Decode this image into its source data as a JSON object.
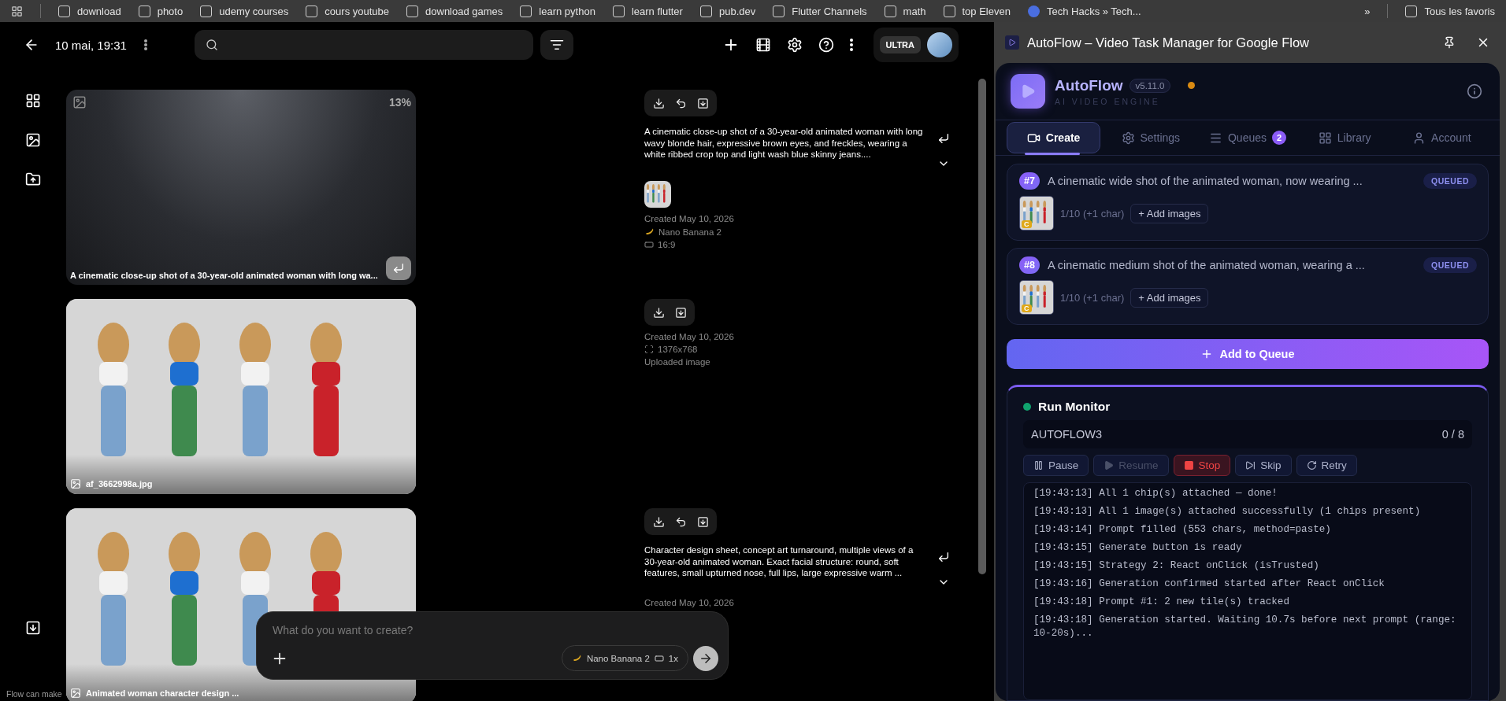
{
  "bookmarks": {
    "items": [
      {
        "label": "download",
        "kind": "folder"
      },
      {
        "label": "photo",
        "kind": "folder"
      },
      {
        "label": "udemy courses",
        "kind": "folder"
      },
      {
        "label": "cours youtube",
        "kind": "folder"
      },
      {
        "label": "download games",
        "kind": "folder"
      },
      {
        "label": "learn python",
        "kind": "folder"
      },
      {
        "label": "learn flutter",
        "kind": "folder"
      },
      {
        "label": "pub.dev",
        "kind": "folder"
      },
      {
        "label": "Flutter Channels",
        "kind": "folder"
      },
      {
        "label": "math",
        "kind": "folder"
      },
      {
        "label": "top Eleven",
        "kind": "folder"
      },
      {
        "label": "Tech Hacks » Tech...",
        "kind": "site"
      }
    ],
    "overflow": "»",
    "all": "Tous les favoris"
  },
  "header": {
    "title": "10 mai, 19:31",
    "plan": "ULTRA"
  },
  "cards": [
    {
      "kind": "progress",
      "progress": "13%",
      "caption": "A cinematic close-up shot of a 30-year-old animated woman with long wa..."
    },
    {
      "kind": "picture",
      "caption": "af_3662998a.jpg"
    },
    {
      "kind": "picture",
      "caption": "Animated woman character design ..."
    }
  ],
  "details": [
    {
      "actions": [
        {
          "kind": "download"
        },
        {
          "kind": "undo"
        },
        {
          "kind": "save"
        }
      ],
      "prompt": "A cinematic close-up shot of a 30-year-old animated woman with long wavy blonde hair, expressive brown eyes, and freckles, wearing a white ribbed crop top and light wash blue skinny jeans....",
      "thumbnail": true,
      "meta": [
        {
          "kind": "date",
          "text": "Created May 10, 2026"
        },
        {
          "kind": "model",
          "text": "Nano Banana 2"
        },
        {
          "kind": "ratio",
          "text": "16:9"
        }
      ]
    },
    {
      "actions": [
        {
          "kind": "download"
        },
        {
          "kind": "save"
        }
      ],
      "thumbnail": false,
      "meta": [
        {
          "kind": "date",
          "text": "Created May 10, 2026"
        },
        {
          "kind": "size",
          "text": "1376x768"
        },
        {
          "kind": "source",
          "text": "Uploaded image"
        }
      ]
    },
    {
      "actions": [
        {
          "kind": "download"
        },
        {
          "kind": "undo"
        },
        {
          "kind": "save"
        }
      ],
      "prompt": "Character design sheet, concept art turnaround, multiple views of a 30-year-old animated woman. Exact facial structure: round, soft features, small upturned nose, full lips, large expressive warm ...",
      "thumbnail": false,
      "meta": [
        {
          "kind": "date",
          "text": "Created May 10, 2026"
        }
      ]
    }
  ],
  "composer": {
    "placeholder": "What do you want to create?",
    "model": "Nano Banana 2",
    "count": "1x"
  },
  "footer_note": "Flow can make",
  "panel": {
    "title": "AutoFlow – Video Task Manager for Google Flow",
    "brand": "AutoFlow",
    "version": "v5.11.0",
    "tagline": "AI VIDEO ENGINE",
    "tabs": [
      {
        "label": "Create",
        "kind": "video",
        "selected": true
      },
      {
        "label": "Settings",
        "kind": "gear",
        "selected": false
      },
      {
        "label": "Queues",
        "kind": "list",
        "badge": "2",
        "selected": false
      },
      {
        "label": "Library",
        "kind": "grid",
        "selected": false
      },
      {
        "label": "Account",
        "kind": "user",
        "selected": false
      }
    ],
    "queue": [
      {
        "number": "#7",
        "prompt": "A cinematic wide shot of the animated woman, now wearing ...",
        "status": "QUEUED",
        "thumb_badge": "C",
        "count": "1/10 (+1 char)",
        "add_label": "+ Add images"
      },
      {
        "number": "#8",
        "prompt": "A cinematic medium shot of the animated woman, wearing a ...",
        "status": "QUEUED",
        "thumb_badge": "C",
        "count": "1/10 (+1 char)",
        "add_label": "+ Add images"
      }
    ],
    "add_button": "Add to Queue",
    "monitor": {
      "title": "Run Monitor",
      "run_name": "AUTOFLOW3",
      "progress": "0 / 8",
      "controls": [
        {
          "label": "Pause",
          "kind": "pause",
          "disabled": false
        },
        {
          "label": "Resume",
          "kind": "resume",
          "disabled": true
        },
        {
          "label": "Stop",
          "kind": "stop",
          "disabled": false
        },
        {
          "label": "Skip",
          "kind": "skip",
          "disabled": false
        },
        {
          "label": "Retry",
          "kind": "retry",
          "disabled": false
        }
      ],
      "log": [
        "[19:43:13] All 1 chip(s) attached — done!",
        "[19:43:13] All 1 image(s) attached successfully (1 chips present)",
        "[19:43:14] Prompt filled (553 chars, method=paste)",
        "[19:43:15] Generate button is ready",
        "[19:43:15] Strategy 2: React onClick (isTrusted)",
        "[19:43:16] Generation confirmed started after React onClick",
        "[19:43:18] Prompt #1: 2 new tile(s) tracked",
        "[19:43:18] Generation started. Waiting 10.7s before next prompt (range: 10-20s)..."
      ]
    }
  }
}
